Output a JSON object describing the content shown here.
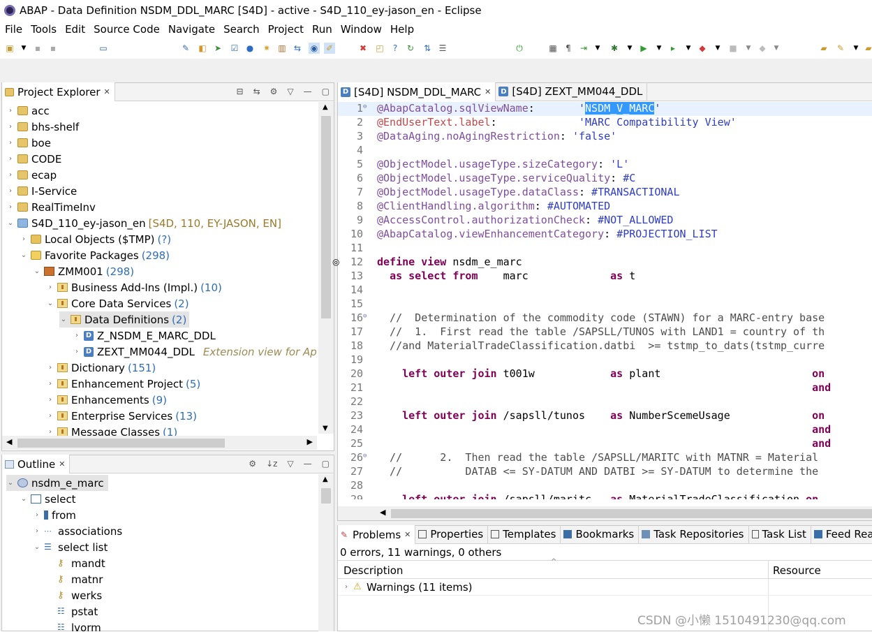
{
  "window": {
    "title": "ABAP - Data Definition NSDM_DDL_MARC [S4D] - active - S4D_110_ey-jason_en - Eclipse"
  },
  "menu": [
    "File",
    "Tools",
    "Edit",
    "Source Code",
    "Navigate",
    "Search",
    "Project",
    "Run",
    "Window",
    "Help"
  ],
  "project_explorer": {
    "tab_label": "Project Explorer",
    "items": [
      {
        "label": "acc"
      },
      {
        "label": "bhs-shelf"
      },
      {
        "label": "boe"
      },
      {
        "label": "CODE"
      },
      {
        "label": "ecap"
      },
      {
        "label": "I-Service"
      },
      {
        "label": "RealTimeInv"
      },
      {
        "label": "S4D_110_ey-jason_en",
        "decoration": "[S4D, 110, EY-JASON, EN]"
      },
      {
        "label": "Local Objects ($TMP)",
        "count": "(?)"
      },
      {
        "label": "Favorite Packages",
        "count": "(298)"
      },
      {
        "label": "ZMM001",
        "count": "(298)"
      },
      {
        "label": "Business Add-Ins (Impl.)",
        "count": "(10)"
      },
      {
        "label": "Core Data Services",
        "count": "(2)"
      },
      {
        "label": "Data Definitions",
        "count": "(2)"
      },
      {
        "label": "Z_NSDM_E_MARC_DDL"
      },
      {
        "label": "ZEXT_MM044_DDL",
        "description": "Extension view for App"
      },
      {
        "label": "Dictionary",
        "count": "(151)"
      },
      {
        "label": "Enhancement Project",
        "count": "(5)"
      },
      {
        "label": "Enhancements",
        "count": "(9)"
      },
      {
        "label": "Enterprise Services",
        "count": "(13)"
      },
      {
        "label": "Message Classes",
        "count": "(1)"
      }
    ]
  },
  "outline": {
    "tab_label": "Outline",
    "items": [
      {
        "label": "nsdm_e_marc"
      },
      {
        "label": "select"
      },
      {
        "label": "from"
      },
      {
        "label": "associations"
      },
      {
        "label": "select list"
      },
      {
        "label": "mandt"
      },
      {
        "label": "matnr"
      },
      {
        "label": "werks"
      },
      {
        "label": "pstat"
      },
      {
        "label": "lvorm"
      }
    ]
  },
  "editor": {
    "tabs": [
      "[S4D] NSDM_DDL_MARC",
      "[S4D] ZEXT_MM044_DDL"
    ],
    "lines": [
      {
        "n": "1",
        "t": "@AbapCatalog.sqlViewName:       'NSDM_V_MARC'"
      },
      {
        "n": "2",
        "t": "@EndUserText.label:             'MARC Compatibility View'"
      },
      {
        "n": "3",
        "t": "@DataAging.noAgingRestriction: 'false'"
      },
      {
        "n": "4",
        "t": ""
      },
      {
        "n": "5",
        "t": "@ObjectModel.usageType.sizeCategory: 'L'"
      },
      {
        "n": "6",
        "t": "@ObjectModel.usageType.serviceQuality: #C"
      },
      {
        "n": "7",
        "t": "@ObjectModel.usageType.dataClass: #TRANSACTIONAL"
      },
      {
        "n": "8",
        "t": "@ClientHandling.algorithm: #AUTOMATED"
      },
      {
        "n": "9",
        "t": "@AccessControl.authorizationCheck: #NOT_ALLOWED"
      },
      {
        "n": "10",
        "t": "@AbapCatalog.viewEnhancementCategory: #PROJECTION_LIST"
      },
      {
        "n": "11",
        "t": ""
      },
      {
        "n": "12",
        "t": "define view nsdm_e_marc"
      },
      {
        "n": "13",
        "t": "  as select from    marc             as t"
      },
      {
        "n": "14",
        "t": ""
      },
      {
        "n": "15",
        "t": ""
      },
      {
        "n": "16",
        "t": "  //  Determination of the commodity code (STAWN) for a MARC-entry base"
      },
      {
        "n": "17",
        "t": "  //  1.  First read the table /SAPSLL/TUNOS with LAND1 = country of th"
      },
      {
        "n": "18",
        "t": "  //and MaterialTradeClassification.datbi  >= tstmp_to_dats(tstmp_curre"
      },
      {
        "n": "19",
        "t": ""
      },
      {
        "n": "20",
        "t": "    left outer join t001w            as plant                        on"
      },
      {
        "n": "21",
        "t": "                                                                     and"
      },
      {
        "n": "22",
        "t": ""
      },
      {
        "n": "23",
        "t": "    left outer join /sapsll/tunos    as NumberScemeUsage             on"
      },
      {
        "n": "24",
        "t": "                                                                     and"
      },
      {
        "n": "25",
        "t": "                                                                     and"
      },
      {
        "n": "26",
        "t": "  //      2.  Then read the table /SAPSLL/MARITC with MATNR = Material"
      },
      {
        "n": "27",
        "t": "  //          DATAB <= SY-DATUM AND DATBI >= SY-DATUM to determine the"
      },
      {
        "n": "28",
        "t": ""
      },
      {
        "n": "29",
        "t": "    left outer join /sapsll/maritc   as MaterialTradeClassification on"
      }
    ]
  },
  "problems": {
    "tabs": [
      "Problems",
      "Properties",
      "Templates",
      "Bookmarks",
      "Task Repositories",
      "Task List",
      "Feed Rea"
    ],
    "summary": "0 errors, 11 warnings, 0 others",
    "columns": [
      "Description",
      "Resource"
    ],
    "rows": [
      {
        "label": "Warnings (11 items)"
      }
    ]
  },
  "watermark": "CSDN @小懒 1510491230@qq.com"
}
